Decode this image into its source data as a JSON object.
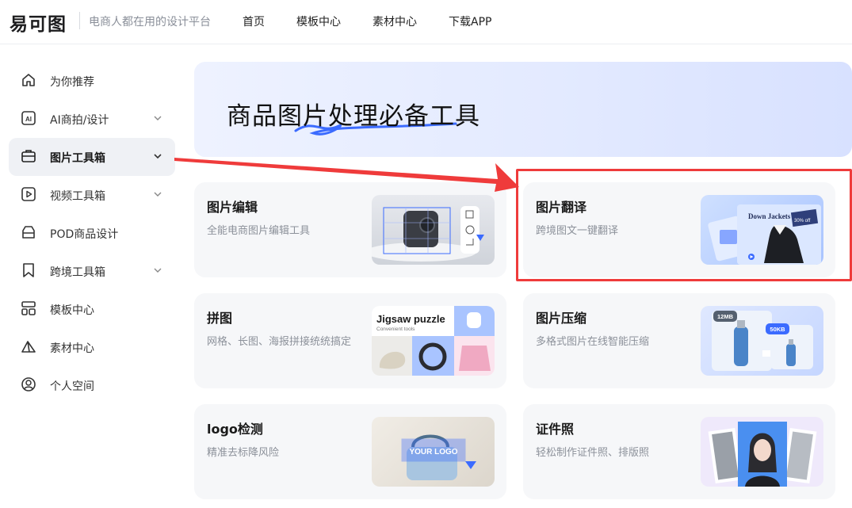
{
  "header": {
    "logo": "易可图",
    "slogan": "电商人都在用的设计平台",
    "nav": [
      {
        "label": "首页"
      },
      {
        "label": "模板中心"
      },
      {
        "label": "素材中心"
      },
      {
        "label": "下载APP"
      }
    ]
  },
  "sidebar": {
    "items": [
      {
        "label": "为你推荐",
        "icon": "home-icon"
      },
      {
        "label": "AI商拍/设计",
        "icon": "ai-icon"
      },
      {
        "label": "图片工具箱",
        "icon": "toolbox-icon"
      },
      {
        "label": "视频工具箱",
        "icon": "video-icon"
      },
      {
        "label": "POD商品设计",
        "icon": "shirt-icon"
      },
      {
        "label": "跨境工具箱",
        "icon": "bookmark-icon"
      },
      {
        "label": "模板中心",
        "icon": "template-icon"
      },
      {
        "label": "素材中心",
        "icon": "material-icon"
      },
      {
        "label": "个人空间",
        "icon": "user-icon"
      }
    ]
  },
  "banner": {
    "title": "商品图片处理必备工具"
  },
  "tools": [
    {
      "title": "图片编辑",
      "desc": "全能电商图片编辑工具"
    },
    {
      "title": "图片翻译",
      "desc": "跨境图文一键翻译",
      "thumb_text": "Down Jackets",
      "thumb_tag": "30% off"
    },
    {
      "title": "拼图",
      "desc": "网格、长图、海报拼接统统搞定",
      "thumb_title": "Jigsaw puzzle",
      "thumb_sub": "Convenient tools"
    },
    {
      "title": "图片压缩",
      "desc": "多格式图片在线智能压缩",
      "size_before": "12MB",
      "size_after": "50KB"
    },
    {
      "title": "logo检测",
      "desc": "精准去标降风险",
      "thumb_text": "YOUR LOGO"
    },
    {
      "title": "证件照",
      "desc": "轻松制作证件照、排版照"
    }
  ],
  "colors": {
    "accent": "#3b6bff",
    "highlight": "#ef3b3b",
    "active_bg": "#eff1f5"
  }
}
